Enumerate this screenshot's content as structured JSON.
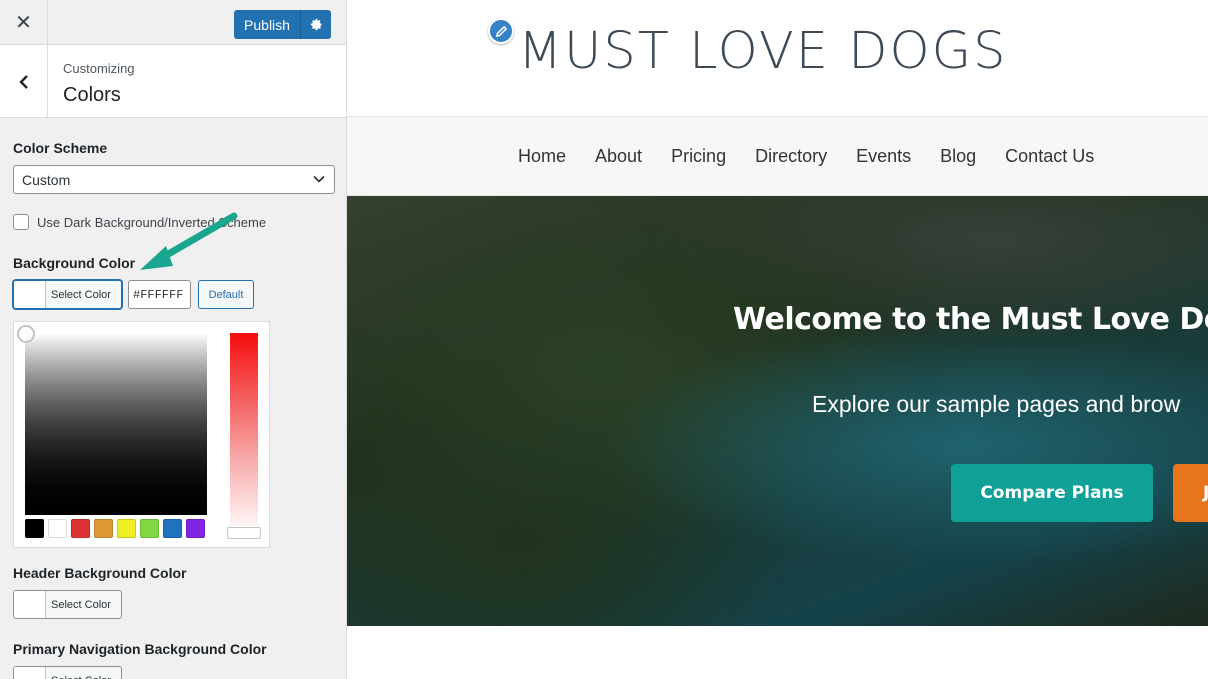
{
  "customizer": {
    "close_icon": "close-icon",
    "publish_label": "Publish",
    "settings_icon": "gear-icon",
    "back_icon": "chevron-left-icon",
    "breadcrumb": "Customizing",
    "section_title": "Colors",
    "color_scheme": {
      "label": "Color Scheme",
      "selected": "Custom"
    },
    "dark_background": {
      "label": "Use Dark Background/Inverted Scheme",
      "checked": false
    },
    "background_color": {
      "label": "Background Color",
      "button_label": "Select Color",
      "hex_value": "#FFFFFF",
      "default_label": "Default",
      "swatch_color": "#FFFFFF"
    },
    "palette": [
      "#000000",
      "#FFFFFF",
      "#DD3333",
      "#DD9933",
      "#EEEE22",
      "#81D742",
      "#1E73BE",
      "#8224E3"
    ],
    "header_background_color": {
      "label": "Header Background Color",
      "button_label": "Select Color"
    },
    "primary_nav_background_color": {
      "label": "Primary Navigation Background Color",
      "button_label": "Select Color"
    },
    "accent_color": "#2271B1",
    "annotation_arrow_color": "#1AA58E"
  },
  "preview": {
    "logo_text": "MUST LOVE DOGS",
    "edit_icon": "pencil-icon",
    "nav": [
      "Home",
      "About",
      "Pricing",
      "Directory",
      "Events",
      "Blog",
      "Contact Us"
    ],
    "hero": {
      "title": "Welcome to the Must Love Do",
      "subtitle": "Explore our sample pages and brow",
      "primary_button": "Compare Plans",
      "secondary_button": "J",
      "primary_button_color": "#0FA198",
      "secondary_button_color": "#E8741B"
    }
  }
}
